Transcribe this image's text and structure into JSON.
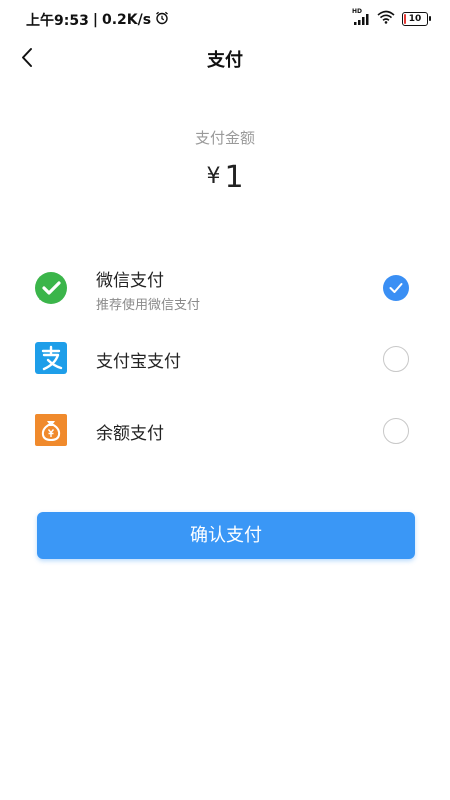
{
  "status_bar": {
    "time": "上午9:53",
    "network_speed": "0.2K/s",
    "signal_label": "HD",
    "battery": "10",
    "battery_level_percent": 10,
    "icons": [
      "alarm-icon",
      "signal-icon",
      "wifi-icon",
      "battery-icon"
    ]
  },
  "header": {
    "title": "支付",
    "back_icon": "back-arrow-icon"
  },
  "amount": {
    "label": "支付金额",
    "currency": "¥",
    "value": "1"
  },
  "payment_methods": [
    {
      "name": "微信支付",
      "subtitle": "推荐使用微信支付",
      "icon": "wechat-icon",
      "icon_color": "#3bb54a",
      "selected": true
    },
    {
      "name": "支付宝支付",
      "subtitle": "",
      "icon": "alipay-icon",
      "icon_color": "#1e9ee9",
      "selected": false
    },
    {
      "name": "余额支付",
      "subtitle": "",
      "icon": "balance-wallet-icon",
      "icon_color": "#f08a2c",
      "selected": false
    }
  ],
  "confirm_button": {
    "label": "确认支付",
    "color": "#3a97f6"
  },
  "colors": {
    "accent": "#3a8ff4",
    "muted_text": "#9a9a9a"
  }
}
